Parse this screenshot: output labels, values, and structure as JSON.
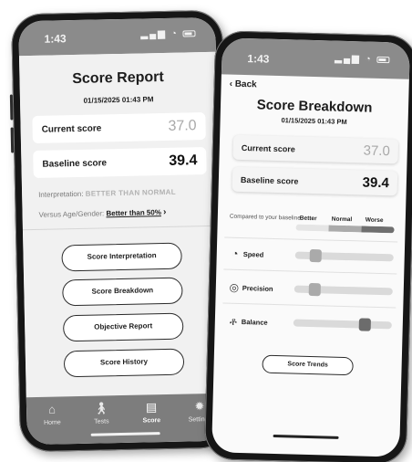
{
  "colors": {
    "status_bar": "#8b8b8b",
    "tab_bar": "#7d7d7d",
    "muted_value": "#a9a9a9",
    "better": "#e5e5e5",
    "normal": "#ababab",
    "worse": "#6f6f6f",
    "thumb_light": "#aaaaaa",
    "thumb_dark": "#6c6c6c"
  },
  "left_phone": {
    "status": {
      "time": "1:43",
      "icons": [
        "signal-icon",
        "wifi-icon",
        "battery-icon"
      ]
    },
    "title": "Score Report",
    "date": "01/15/2025 01:43 PM",
    "current": {
      "label": "Current score",
      "value": "37.0"
    },
    "baseline": {
      "label": "Baseline score",
      "value": "39.4"
    },
    "interpretation": {
      "label": "Interpretation:",
      "value": "BETTER THAN NORMAL"
    },
    "versus": {
      "label": "Versus Age/Gender:",
      "value": "Better than 50%",
      "chevron": "›"
    },
    "buttons": [
      "Score Interpretation",
      "Score Breakdown",
      "Objective Report",
      "Score History"
    ],
    "tabs": [
      {
        "label": "Home",
        "icon": "home-icon"
      },
      {
        "label": "Tests",
        "icon": "walking-person-icon"
      },
      {
        "label": "Score",
        "icon": "score-document-icon",
        "active": true
      },
      {
        "label": "Settings",
        "icon": "gear-icon"
      }
    ]
  },
  "right_phone": {
    "status": {
      "time": "1:43",
      "icons": [
        "signal-icon",
        "wifi-icon",
        "battery-icon"
      ]
    },
    "back": "Back",
    "title": "Score Breakdown",
    "date": "01/15/2025 01:43 PM",
    "current": {
      "label": "Current score",
      "value": "37.0"
    },
    "baseline": {
      "label": "Baseline score",
      "value": "39.4"
    },
    "compared_label": "Compared to your baseline",
    "legend": [
      "Better",
      "Normal",
      "Worse"
    ],
    "metrics": [
      {
        "label": "Speed",
        "icon": "speed-icon",
        "level": 0.2,
        "tone": "light"
      },
      {
        "label": "Precision",
        "icon": "precision-target-icon",
        "level": 0.2,
        "tone": "light"
      },
      {
        "label": "Balance",
        "icon": "balance-figure-icon",
        "level": 0.72,
        "tone": "dark"
      }
    ],
    "trends_button": "Score Trends"
  }
}
